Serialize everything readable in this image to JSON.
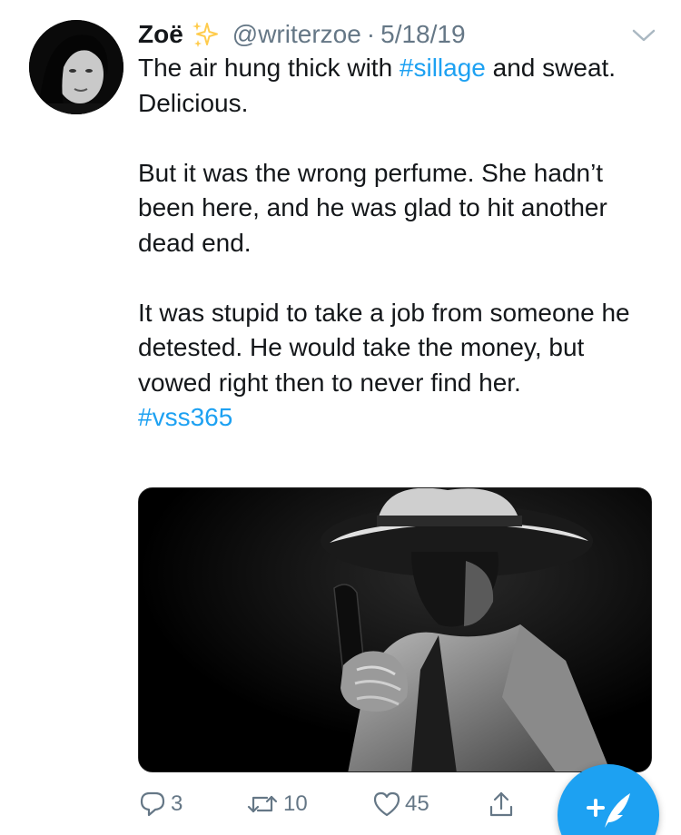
{
  "tweet": {
    "display_name": "Zoë",
    "badge_icon": "sparkles-icon",
    "handle": "@writerzoe",
    "separator": "·",
    "date": "5/18/19",
    "text": {
      "line1_before": "The air hung thick with ",
      "line1_hashtag": "#sillage",
      "line1_after": " and sweat. Delicious.",
      "para2": "But it was the wrong perfume. She hadn’t been here, and he was glad to hit another dead end.",
      "para3": "It was stupid to take a job from someone he detested. He would take the money, but vowed right then to never find her.",
      "hashtag": "#vss365"
    },
    "media_icon": "noir-detective-photo"
  },
  "actions": {
    "reply_count": "3",
    "retweet_count": "10",
    "like_count": "45"
  },
  "colors": {
    "accent": "#1da1f2",
    "muted": "#657786",
    "text": "#14171a",
    "sparkle": "#ffcc4d"
  }
}
